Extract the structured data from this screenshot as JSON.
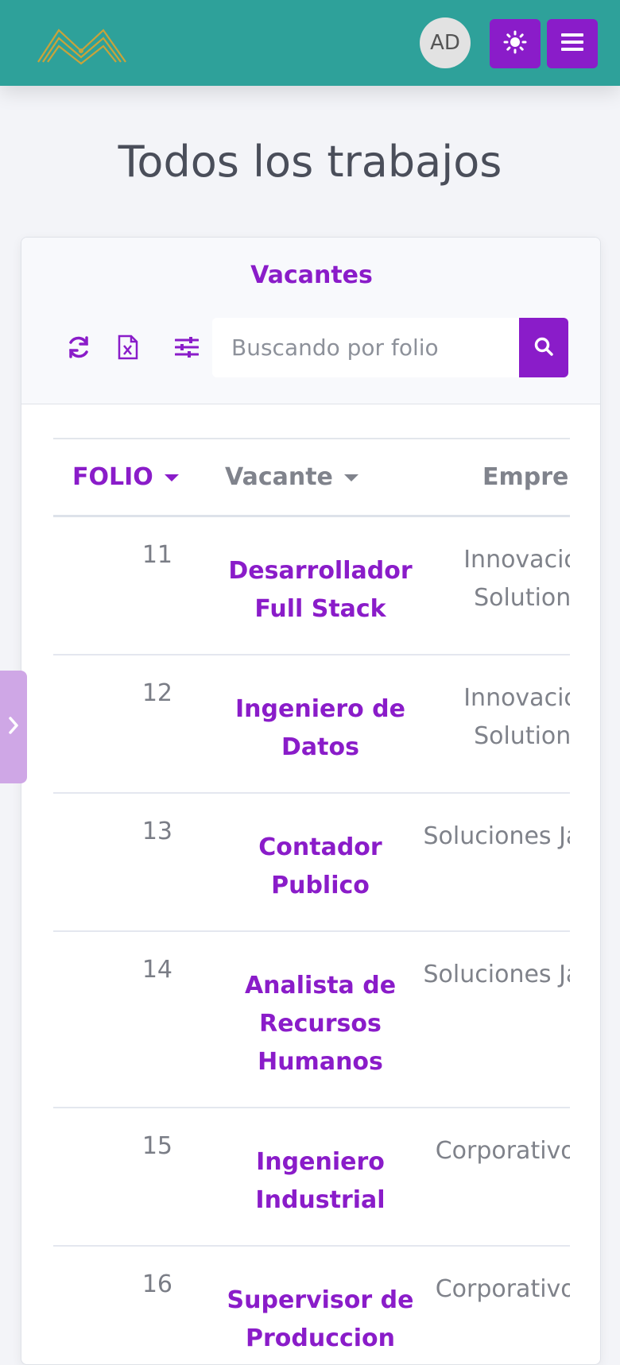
{
  "header": {
    "logo_icon": "mountains-logo-icon",
    "avatar_initials": "AD",
    "theme_icon": "sun-icon",
    "menu_icon": "hamburger-menu-icon"
  },
  "page": {
    "title": "Todos los trabajos"
  },
  "card": {
    "title": "Vacantes",
    "tools": [
      "refresh-icon",
      "excel-file-icon",
      "sliders-icon"
    ],
    "search": {
      "placeholder": "Buscando por folio",
      "value": "",
      "button_icon": "search-icon"
    }
  },
  "table": {
    "columns": [
      "FOLIO",
      "Vacante",
      "Empresa"
    ],
    "rows": [
      {
        "folio": "11",
        "vacante": "Desarrollador Full Stack",
        "empresa": "Innovación Solutions"
      },
      {
        "folio": "12",
        "vacante": "Ingeniero de Datos",
        "empresa": "Innovación Solutions"
      },
      {
        "folio": "13",
        "vacante": "Contador Publico",
        "empresa": "Soluciones Jalisco"
      },
      {
        "folio": "14",
        "vacante": "Analista de Recursos Humanos",
        "empresa": "Soluciones Jalisco"
      },
      {
        "folio": "15",
        "vacante": "Ingeniero Industrial",
        "empresa": "Corporativo MG"
      },
      {
        "folio": "16",
        "vacante": "Supervisor de Produccion",
        "empresa": "Corporativo MG"
      }
    ]
  },
  "sidebar_toggle_icon": "chevron-right-icon",
  "colors": {
    "header_bg": "#2ea19a",
    "accent": "#8a1cc9",
    "logo_gold": "#c9a33a"
  }
}
